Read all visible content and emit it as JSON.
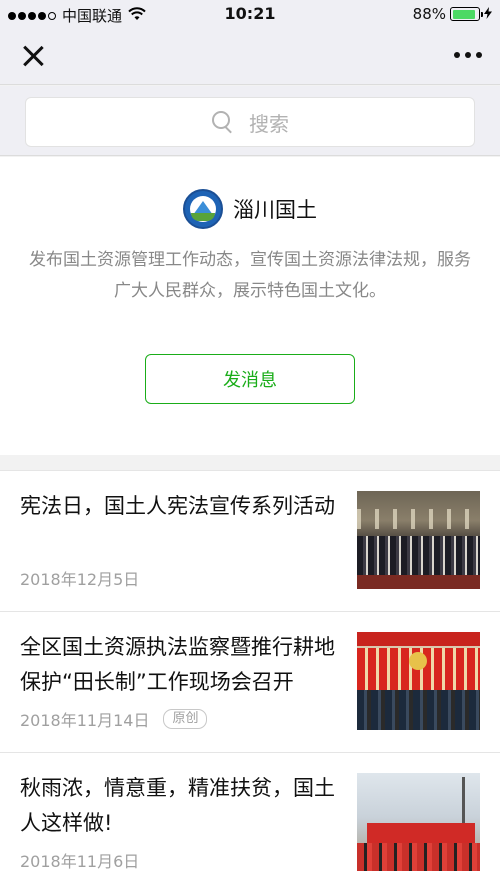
{
  "status_bar": {
    "carrier": "中国联通",
    "time": "10:21",
    "battery": "88%",
    "battery_level": 0.88
  },
  "nav": {
    "close_icon": "close-icon",
    "more_icon": "more-icon"
  },
  "search": {
    "placeholder": "搜索"
  },
  "profile": {
    "name": "淄川国土",
    "description": "发布国土资源管理工作动态，宣传国土资源法律法规，服务广大人民群众，展示特色国土文化。",
    "send_button": "发消息"
  },
  "articles": [
    {
      "title": "宪法日，国土人宪法宣传系列活动",
      "date": "2018年12月5日",
      "tag": ""
    },
    {
      "title": "全区国土资源执法监察暨推行耕地保护“田长制”工作现场会召开",
      "date": "2018年11月14日",
      "tag": "原创"
    },
    {
      "title": "秋雨浓，情意重，精准扶贫，国土人这样做!",
      "date": "2018年11月6日",
      "tag": ""
    }
  ],
  "colors": {
    "accent_green": "#1aad19",
    "battery_green": "#4cd964"
  }
}
